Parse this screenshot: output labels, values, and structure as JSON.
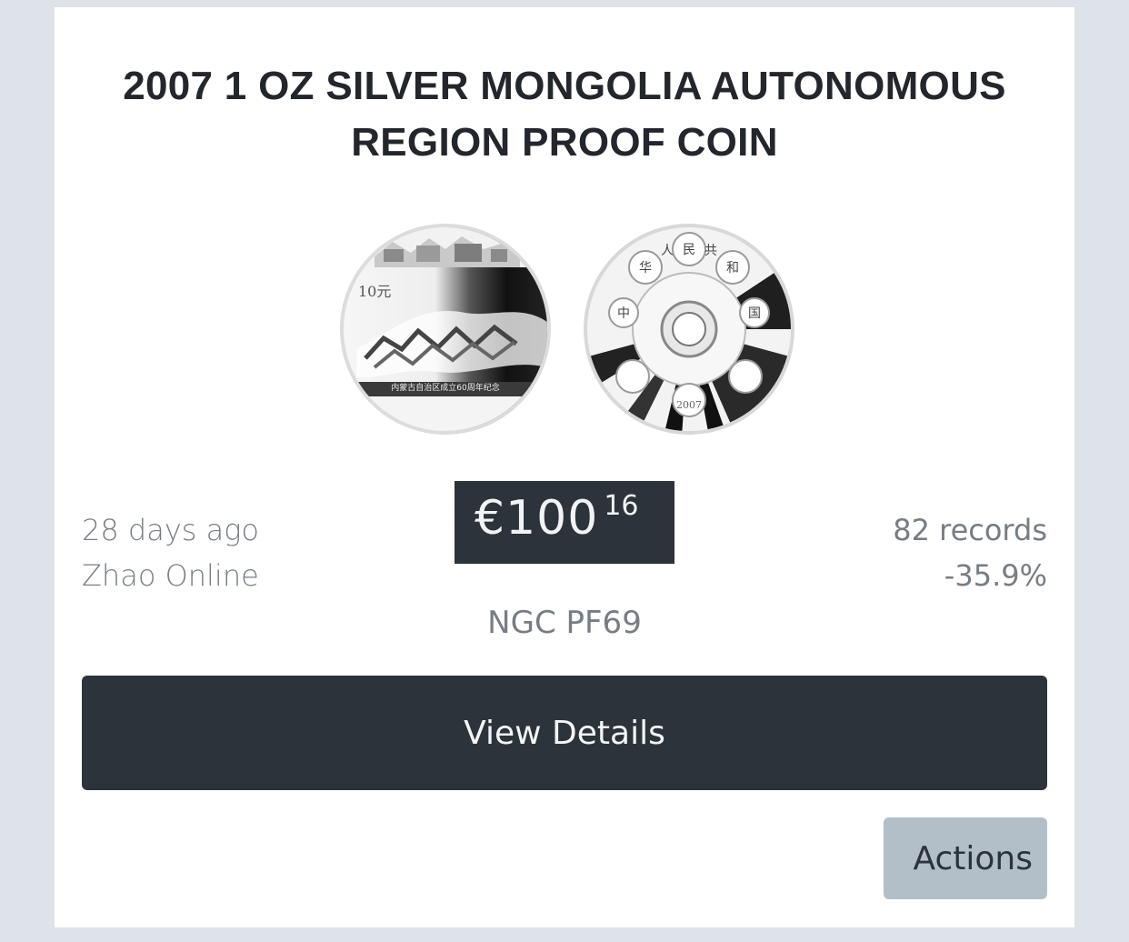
{
  "listing": {
    "title": "2007 1 OZ SILVER MONGOLIA AUTONOMOUS REGION PROOF COIN",
    "age": "28 days ago",
    "seller": "Zhao Online",
    "records": "82 records",
    "change": "-35.9%",
    "grade": "NGC PF69",
    "price": {
      "main": "€100",
      "cents": "16"
    }
  },
  "coins": {
    "obverse": {
      "icon": "coin-obverse-image",
      "denomination": "10元",
      "inscription": "内蒙古自治区成立60周年纪念"
    },
    "reverse": {
      "icon": "coin-reverse-image",
      "characters": [
        "中",
        "华",
        "人",
        "民",
        "共",
        "和",
        "国"
      ],
      "year": "2007"
    }
  },
  "buttons": {
    "view_details": "View Details",
    "actions": "Actions"
  },
  "colors": {
    "page_bg": "#dee3ea",
    "card_bg": "#ffffff",
    "dark": "#2d333b",
    "muted_text": "#777d84",
    "actions_bg": "#b3bfc8"
  }
}
